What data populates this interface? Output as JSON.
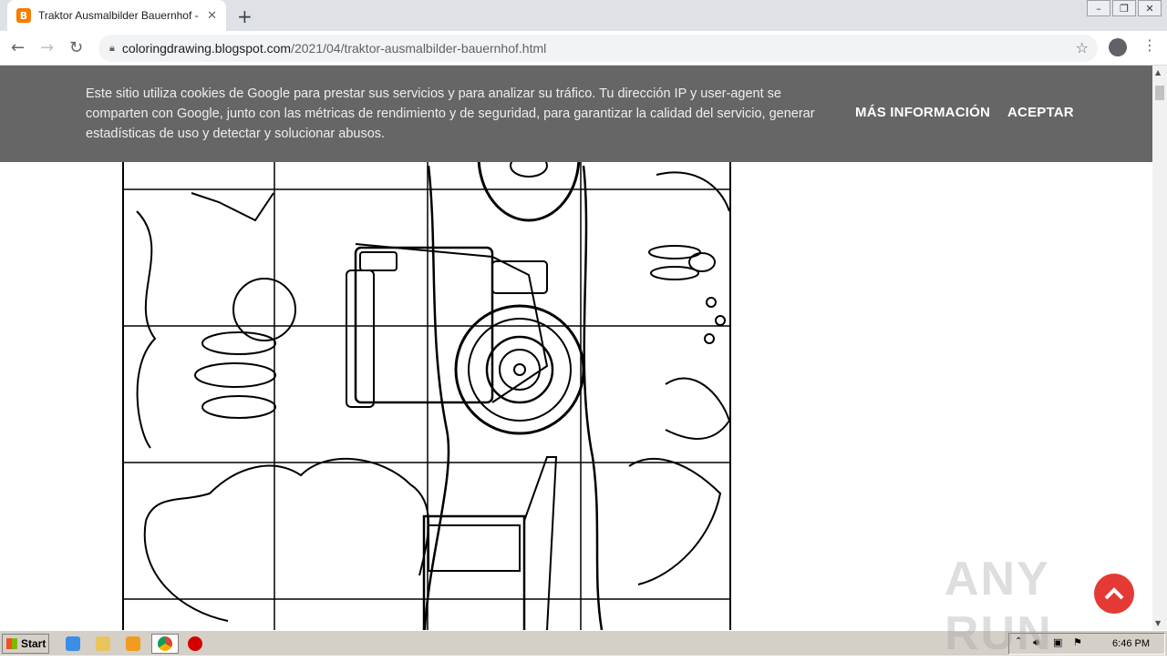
{
  "browser": {
    "tab_title": "Traktor Ausmalbilder Bauernhof - Co",
    "tab_favicon": "B",
    "url_host": "coloringdrawing.blogspot.com",
    "url_path": "/2021/04/traktor-ausmalbilder-bauernhof.html"
  },
  "cookie_banner": {
    "message": "Este sitio utiliza cookies de Google para prestar sus servicios y para analizar su tráfico. Tu dirección IP y user-agent se comparten con Google, junto con las métricas de rendimiento y de seguridad, para garantizar la calidad del servicio, generar estadísticas de uso y detectar y solucionar abusos.",
    "more_info": "MÁS INFORMACIÓN",
    "accept": "ACEPTAR"
  },
  "watermark": "ANY RUN",
  "taskbar": {
    "start_label": "Start",
    "clock": "6:46 PM"
  },
  "colors": {
    "banner_bg": "#666666",
    "to_top_button": "#e53935",
    "favicon": "#f57d00"
  }
}
